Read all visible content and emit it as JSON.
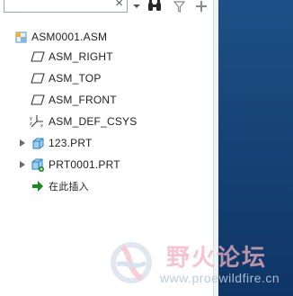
{
  "colors": {
    "panel_bg": "#ffffff",
    "graphics_bg": "#164478",
    "insert_arrow": "#1c8a1c",
    "part_icon": "#3aa0d8",
    "watermark_text": "#f3b0c0"
  },
  "search": {
    "value": "",
    "clear_glyph": "×"
  },
  "toolbar": {
    "icons": [
      "dropdown-icon",
      "find-icon",
      "filter-icon",
      "add-icon"
    ]
  },
  "tree": {
    "root": {
      "label": "ASM0001.ASM",
      "icon": "assembly-icon"
    },
    "items": [
      {
        "label": "ASM_RIGHT",
        "icon": "datum-plane-icon"
      },
      {
        "label": "ASM_TOP",
        "icon": "datum-plane-icon"
      },
      {
        "label": "ASM_FRONT",
        "icon": "datum-plane-icon"
      },
      {
        "label": "ASM_DEF_CSYS",
        "icon": "csys-icon"
      },
      {
        "label": "123.PRT",
        "icon": "part-icon",
        "expandable": true
      },
      {
        "label": "PRT0001.PRT",
        "icon": "part-new-icon",
        "expandable": true
      },
      {
        "label": "在此插入",
        "icon": "insert-here-icon"
      }
    ]
  },
  "watermark": {
    "title": "野火论坛",
    "url": "www.proewildfire.cn"
  }
}
